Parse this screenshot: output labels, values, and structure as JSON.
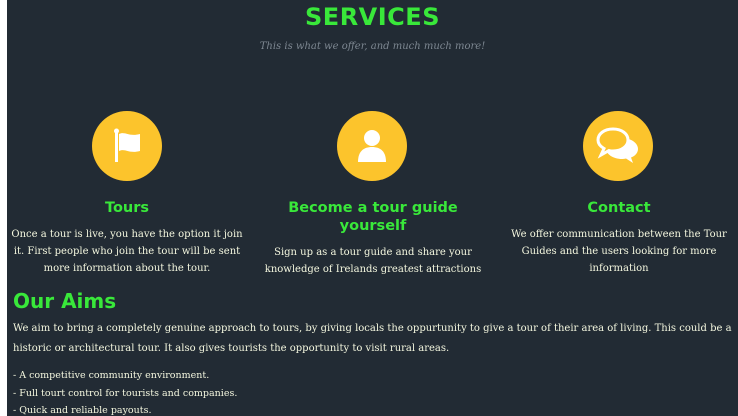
{
  "services": {
    "title": "SERVICES",
    "subtitle": "This is what we offer, and much much more!",
    "accent_color": "#39e83a",
    "icon_bg_color": "#fcc42c",
    "items": [
      {
        "icon": "flag-icon",
        "title": "Tours",
        "lines": [
          "Once a tour is live, you have the option it join",
          "it. First people who join the tour will be sent",
          "more information about the tour."
        ]
      },
      {
        "icon": "user-icon",
        "title_lines": [
          "Become a tour guide",
          "yourself"
        ],
        "lines": [
          "Sign up as a tour guide and share your",
          "knowledge of Irelands greatest attractions"
        ]
      },
      {
        "icon": "chat-bubbles-icon",
        "title": "Contact",
        "lines": [
          "We offer communication between the Tour",
          "Guides and the users looking for more",
          "information"
        ]
      }
    ]
  },
  "aims": {
    "title": "Our Aims",
    "text_lines": [
      "We aim to bring a completely genuine approach to tours, by giving locals the oppurtunity to give a tour of their area of living. This could be a",
      "historic or architectural tour. It also gives tourists the opportunity to visit rural areas."
    ],
    "list": [
      "- A competitive community environment.",
      "- Full tourt control for tourists and companies.",
      "- Quick and reliable payouts."
    ]
  }
}
